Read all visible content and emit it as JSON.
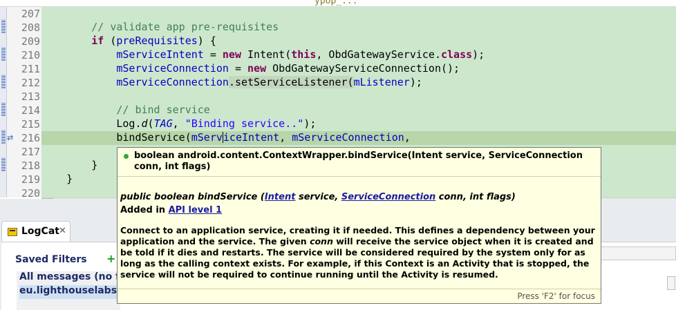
{
  "editor": {
    "top_fragment": "ypop_...",
    "lines": [
      {
        "num": "207"
      },
      {
        "num": "208"
      },
      {
        "num": "209"
      },
      {
        "num": "210"
      },
      {
        "num": "211"
      },
      {
        "num": "212"
      },
      {
        "num": "213"
      },
      {
        "num": "214"
      },
      {
        "num": "215"
      },
      {
        "num": "216"
      },
      {
        "num": "217"
      },
      {
        "num": "218"
      },
      {
        "num": "219"
      },
      {
        "num": "220"
      }
    ],
    "code": {
      "l208_comment": "// validate app pre-requisites",
      "l209_kw": "if",
      "l209_field": "preRequisites",
      "l210_field": "mServiceIntent",
      "l210_new": "new",
      "l210_ctor": "Intent(",
      "l210_this": "this",
      "l210_rest": ", ObdGatewayService.",
      "l210_class": "class",
      "l210_end": ");",
      "l211_field": "mServiceConnection",
      "l211_new": "new",
      "l211_rest": "ObdGatewayServiceConnection();",
      "l212_field": "mServiceConnection",
      "l212_method": ".setServiceListener(",
      "l212_arg": "mListener",
      "l212_end": ");",
      "l214_comment": "// bind service",
      "l215_log": "Log.",
      "l215_d": "d",
      "l215_tag": "TAG",
      "l215_str": "\"Binding service..\"",
      "l215_end": ");",
      "l216_method": "bindService(",
      "l216_arg1a": "mServ",
      "l216_arg1b": "iceIntent",
      "l216_sep": ", ",
      "l216_arg2": "mServiceConnection",
      "l216_end": ",",
      "l218_brace": "}",
      "l219_brace": "}"
    }
  },
  "logcat": {
    "tab_label": "LogCat",
    "close_glyph": "✕",
    "saved_filters_title": "Saved Filters",
    "add_glyph": "+",
    "filters": [
      {
        "label": "All messages (no filte"
      },
      {
        "label": "eu.lighthouselabs.ob"
      }
    ]
  },
  "popup": {
    "signature": "boolean android.content.ContextWrapper.bindService(Intent service, ServiceConnection conn, int flags)",
    "doc_sig_prefix": "public boolean bindService (",
    "doc_sig_link1": "Intent",
    "doc_sig_mid1": " service, ",
    "doc_sig_link2": "ServiceConnection",
    "doc_sig_suffix": " conn, int flags)",
    "added_prefix": "Added in ",
    "added_link": "API level 1",
    "desc_part1": "Connect to an application service, creating it if needed. This defines a dependency between your application and the service. The given ",
    "desc_conn": "conn",
    "desc_part2": " will receive the service object when it is created and be told if it dies and restarts. The service will be considered required by the system only for as long as the calling context exists. For example, if this Context is an Activity that is stopped, the service will not be required to continue running until the Activity is resumed.",
    "footer_hint": "Press 'F2' for focus"
  },
  "colors": {
    "code_background": "#cde7cd",
    "current_line": "#b7d6a9",
    "keyword": "#7f0055",
    "comment": "#3f7f5f",
    "field": "#0000c0",
    "string": "#2a00ff",
    "popup_background": "#ffffe1",
    "link": "#1a1aa6"
  }
}
